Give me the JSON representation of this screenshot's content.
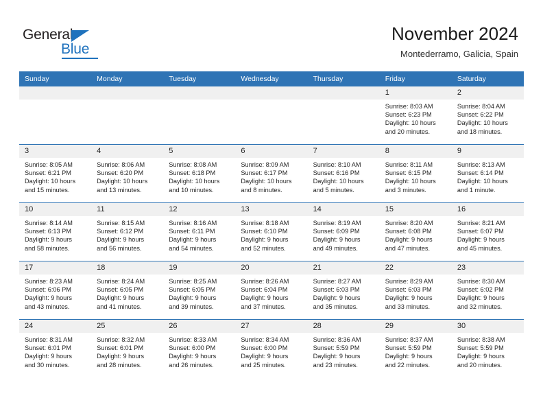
{
  "brand": {
    "name_part1": "General",
    "name_part2": "Blue"
  },
  "header": {
    "title": "November 2024",
    "location": "Montederramo, Galicia, Spain"
  },
  "theme": {
    "header_blue": "#2f74b5",
    "daynum_gray": "#f0f0f0",
    "logo_blue": "#1f72bd",
    "text": "#262626"
  },
  "weekday_headers": [
    "Sunday",
    "Monday",
    "Tuesday",
    "Wednesday",
    "Thursday",
    "Friday",
    "Saturday"
  ],
  "weeks": [
    [
      {
        "day": "",
        "sunrise": "",
        "sunset": "",
        "daylight_line1": "",
        "daylight_line2": "",
        "empty": true
      },
      {
        "day": "",
        "sunrise": "",
        "sunset": "",
        "daylight_line1": "",
        "daylight_line2": "",
        "empty": true
      },
      {
        "day": "",
        "sunrise": "",
        "sunset": "",
        "daylight_line1": "",
        "daylight_line2": "",
        "empty": true
      },
      {
        "day": "",
        "sunrise": "",
        "sunset": "",
        "daylight_line1": "",
        "daylight_line2": "",
        "empty": true
      },
      {
        "day": "",
        "sunrise": "",
        "sunset": "",
        "daylight_line1": "",
        "daylight_line2": "",
        "empty": true
      },
      {
        "day": "1",
        "sunrise": "Sunrise: 8:03 AM",
        "sunset": "Sunset: 6:23 PM",
        "daylight_line1": "Daylight: 10 hours",
        "daylight_line2": "and 20 minutes.",
        "empty": false
      },
      {
        "day": "2",
        "sunrise": "Sunrise: 8:04 AM",
        "sunset": "Sunset: 6:22 PM",
        "daylight_line1": "Daylight: 10 hours",
        "daylight_line2": "and 18 minutes.",
        "empty": false
      }
    ],
    [
      {
        "day": "3",
        "sunrise": "Sunrise: 8:05 AM",
        "sunset": "Sunset: 6:21 PM",
        "daylight_line1": "Daylight: 10 hours",
        "daylight_line2": "and 15 minutes.",
        "empty": false
      },
      {
        "day": "4",
        "sunrise": "Sunrise: 8:06 AM",
        "sunset": "Sunset: 6:20 PM",
        "daylight_line1": "Daylight: 10 hours",
        "daylight_line2": "and 13 minutes.",
        "empty": false
      },
      {
        "day": "5",
        "sunrise": "Sunrise: 8:08 AM",
        "sunset": "Sunset: 6:18 PM",
        "daylight_line1": "Daylight: 10 hours",
        "daylight_line2": "and 10 minutes.",
        "empty": false
      },
      {
        "day": "6",
        "sunrise": "Sunrise: 8:09 AM",
        "sunset": "Sunset: 6:17 PM",
        "daylight_line1": "Daylight: 10 hours",
        "daylight_line2": "and 8 minutes.",
        "empty": false
      },
      {
        "day": "7",
        "sunrise": "Sunrise: 8:10 AM",
        "sunset": "Sunset: 6:16 PM",
        "daylight_line1": "Daylight: 10 hours",
        "daylight_line2": "and 5 minutes.",
        "empty": false
      },
      {
        "day": "8",
        "sunrise": "Sunrise: 8:11 AM",
        "sunset": "Sunset: 6:15 PM",
        "daylight_line1": "Daylight: 10 hours",
        "daylight_line2": "and 3 minutes.",
        "empty": false
      },
      {
        "day": "9",
        "sunrise": "Sunrise: 8:13 AM",
        "sunset": "Sunset: 6:14 PM",
        "daylight_line1": "Daylight: 10 hours",
        "daylight_line2": "and 1 minute.",
        "empty": false
      }
    ],
    [
      {
        "day": "10",
        "sunrise": "Sunrise: 8:14 AM",
        "sunset": "Sunset: 6:13 PM",
        "daylight_line1": "Daylight: 9 hours",
        "daylight_line2": "and 58 minutes.",
        "empty": false
      },
      {
        "day": "11",
        "sunrise": "Sunrise: 8:15 AM",
        "sunset": "Sunset: 6:12 PM",
        "daylight_line1": "Daylight: 9 hours",
        "daylight_line2": "and 56 minutes.",
        "empty": false
      },
      {
        "day": "12",
        "sunrise": "Sunrise: 8:16 AM",
        "sunset": "Sunset: 6:11 PM",
        "daylight_line1": "Daylight: 9 hours",
        "daylight_line2": "and 54 minutes.",
        "empty": false
      },
      {
        "day": "13",
        "sunrise": "Sunrise: 8:18 AM",
        "sunset": "Sunset: 6:10 PM",
        "daylight_line1": "Daylight: 9 hours",
        "daylight_line2": "and 52 minutes.",
        "empty": false
      },
      {
        "day": "14",
        "sunrise": "Sunrise: 8:19 AM",
        "sunset": "Sunset: 6:09 PM",
        "daylight_line1": "Daylight: 9 hours",
        "daylight_line2": "and 49 minutes.",
        "empty": false
      },
      {
        "day": "15",
        "sunrise": "Sunrise: 8:20 AM",
        "sunset": "Sunset: 6:08 PM",
        "daylight_line1": "Daylight: 9 hours",
        "daylight_line2": "and 47 minutes.",
        "empty": false
      },
      {
        "day": "16",
        "sunrise": "Sunrise: 8:21 AM",
        "sunset": "Sunset: 6:07 PM",
        "daylight_line1": "Daylight: 9 hours",
        "daylight_line2": "and 45 minutes.",
        "empty": false
      }
    ],
    [
      {
        "day": "17",
        "sunrise": "Sunrise: 8:23 AM",
        "sunset": "Sunset: 6:06 PM",
        "daylight_line1": "Daylight: 9 hours",
        "daylight_line2": "and 43 minutes.",
        "empty": false
      },
      {
        "day": "18",
        "sunrise": "Sunrise: 8:24 AM",
        "sunset": "Sunset: 6:05 PM",
        "daylight_line1": "Daylight: 9 hours",
        "daylight_line2": "and 41 minutes.",
        "empty": false
      },
      {
        "day": "19",
        "sunrise": "Sunrise: 8:25 AM",
        "sunset": "Sunset: 6:05 PM",
        "daylight_line1": "Daylight: 9 hours",
        "daylight_line2": "and 39 minutes.",
        "empty": false
      },
      {
        "day": "20",
        "sunrise": "Sunrise: 8:26 AM",
        "sunset": "Sunset: 6:04 PM",
        "daylight_line1": "Daylight: 9 hours",
        "daylight_line2": "and 37 minutes.",
        "empty": false
      },
      {
        "day": "21",
        "sunrise": "Sunrise: 8:27 AM",
        "sunset": "Sunset: 6:03 PM",
        "daylight_line1": "Daylight: 9 hours",
        "daylight_line2": "and 35 minutes.",
        "empty": false
      },
      {
        "day": "22",
        "sunrise": "Sunrise: 8:29 AM",
        "sunset": "Sunset: 6:03 PM",
        "daylight_line1": "Daylight: 9 hours",
        "daylight_line2": "and 33 minutes.",
        "empty": false
      },
      {
        "day": "23",
        "sunrise": "Sunrise: 8:30 AM",
        "sunset": "Sunset: 6:02 PM",
        "daylight_line1": "Daylight: 9 hours",
        "daylight_line2": "and 32 minutes.",
        "empty": false
      }
    ],
    [
      {
        "day": "24",
        "sunrise": "Sunrise: 8:31 AM",
        "sunset": "Sunset: 6:01 PM",
        "daylight_line1": "Daylight: 9 hours",
        "daylight_line2": "and 30 minutes.",
        "empty": false
      },
      {
        "day": "25",
        "sunrise": "Sunrise: 8:32 AM",
        "sunset": "Sunset: 6:01 PM",
        "daylight_line1": "Daylight: 9 hours",
        "daylight_line2": "and 28 minutes.",
        "empty": false
      },
      {
        "day": "26",
        "sunrise": "Sunrise: 8:33 AM",
        "sunset": "Sunset: 6:00 PM",
        "daylight_line1": "Daylight: 9 hours",
        "daylight_line2": "and 26 minutes.",
        "empty": false
      },
      {
        "day": "27",
        "sunrise": "Sunrise: 8:34 AM",
        "sunset": "Sunset: 6:00 PM",
        "daylight_line1": "Daylight: 9 hours",
        "daylight_line2": "and 25 minutes.",
        "empty": false
      },
      {
        "day": "28",
        "sunrise": "Sunrise: 8:36 AM",
        "sunset": "Sunset: 5:59 PM",
        "daylight_line1": "Daylight: 9 hours",
        "daylight_line2": "and 23 minutes.",
        "empty": false
      },
      {
        "day": "29",
        "sunrise": "Sunrise: 8:37 AM",
        "sunset": "Sunset: 5:59 PM",
        "daylight_line1": "Daylight: 9 hours",
        "daylight_line2": "and 22 minutes.",
        "empty": false
      },
      {
        "day": "30",
        "sunrise": "Sunrise: 8:38 AM",
        "sunset": "Sunset: 5:59 PM",
        "daylight_line1": "Daylight: 9 hours",
        "daylight_line2": "and 20 minutes.",
        "empty": false
      }
    ]
  ]
}
